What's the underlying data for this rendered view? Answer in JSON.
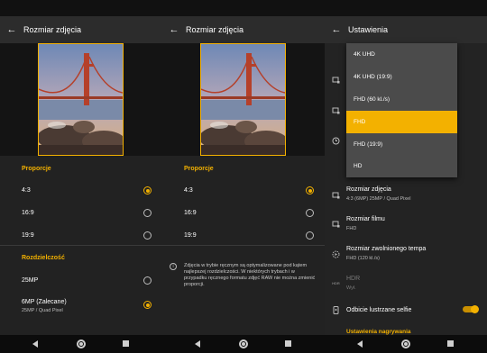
{
  "panel1": {
    "title": "Rozmiar zdjęcia",
    "sections": [
      {
        "heading": "Proporcje",
        "options": [
          {
            "label": "4:3",
            "selected": true
          },
          {
            "label": "16:9",
            "selected": false
          },
          {
            "label": "19:9",
            "selected": false
          }
        ]
      },
      {
        "heading": "Rozdzielczość",
        "options": [
          {
            "label": "25MP",
            "sub": "",
            "selected": false
          },
          {
            "label": "6MP (Zalecane)",
            "sub": "25MP / Quad Pixel",
            "selected": true
          }
        ]
      }
    ]
  },
  "panel2": {
    "title": "Rozmiar zdjęcia",
    "section_heading": "Proporcje",
    "options": [
      {
        "label": "4:3",
        "selected": true
      },
      {
        "label": "16:9",
        "selected": false
      },
      {
        "label": "19:9",
        "selected": false
      }
    ],
    "info": "Zdjęcia w trybie ręcznym są optymalizowane pod kątem najlepszej rozdzielczości. W niektórych trybach i w przypadku ręcznego formatu zdjęć RAW nie można zmienić proporcji."
  },
  "panel3": {
    "title": "Ustawienia",
    "dropdown": [
      {
        "label": "4K UHD",
        "selected": false
      },
      {
        "label": "4K UHD (19:9)",
        "selected": false
      },
      {
        "label": "FHD (60 kl./s)",
        "selected": false
      },
      {
        "label": "FHD",
        "selected": true
      },
      {
        "label": "FHD (19:9)",
        "selected": false
      },
      {
        "label": "HD",
        "selected": false
      }
    ],
    "settings": [
      {
        "title": "Rozmiar zdjęcia",
        "sub": "4:3 (6MP) 25MP / Quad Pixel"
      },
      {
        "title": "Rozmiar filmu",
        "sub": "FHD"
      },
      {
        "title": "Rozmiar zwolnionego tempa",
        "sub": "FHD (120 kl./s)"
      },
      {
        "title": "HDR",
        "sub": "Wył."
      },
      {
        "title": "Odbicie lustrzane selfie",
        "sub": ""
      }
    ],
    "hdr_icon_text": "HDR",
    "mirror_toggle_on": true,
    "section_cut": "Ustawienia nagrywania"
  },
  "colors": {
    "accent": "#f3b100",
    "background": "#222222"
  },
  "icons": {
    "back": "arrow-left-icon",
    "nav_back": "triangle-back-icon",
    "nav_home": "home-circle-icon",
    "nav_recent": "square-recent-icon"
  }
}
